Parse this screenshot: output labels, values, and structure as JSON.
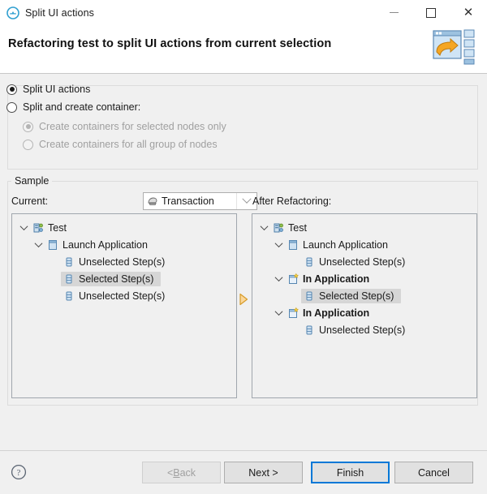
{
  "window": {
    "title": "Split UI actions",
    "icon": "split-ui-actions-icon",
    "controls": {
      "minimize": "minimize-icon",
      "maximize": "maximize-icon",
      "close": "close-icon"
    }
  },
  "header": {
    "title": "Refactoring test to split UI actions from current selection",
    "banner_icon": "refactoring-wizard-banner-icon"
  },
  "options": {
    "split_ui_actions": {
      "label": "Split UI actions",
      "checked": true,
      "enabled": true
    },
    "split_and_create_container": {
      "label": "Split and create container:",
      "checked": false,
      "enabled": true
    },
    "container_type": {
      "value": "Transaction",
      "icon": "transaction-icon"
    },
    "sub_selected_nodes_only": {
      "label": "Create containers for selected nodes only",
      "checked": true,
      "enabled": false
    },
    "sub_all_group_of_nodes": {
      "label": "Create containers for all group of nodes",
      "checked": false,
      "enabled": false
    }
  },
  "sample": {
    "legend": "Sample",
    "current_label": "Current:",
    "after_label": "After Refactoring:",
    "arrow_icon": "arrow-right-icon",
    "current_tree": [
      {
        "label": "Test",
        "indent": 0,
        "icon": "test-icon",
        "twisty": "expanded",
        "bold": false,
        "selected": false
      },
      {
        "label": "Launch Application",
        "indent": 1,
        "icon": "application-icon",
        "twisty": "expanded",
        "bold": false,
        "selected": false
      },
      {
        "label": "Unselected Step(s)",
        "indent": 2,
        "icon": "step-icon",
        "twisty": "none",
        "bold": false,
        "selected": false
      },
      {
        "label": "Selected Step(s)",
        "indent": 2,
        "icon": "step-icon",
        "twisty": "none",
        "bold": false,
        "selected": true
      },
      {
        "label": "Unselected Step(s)",
        "indent": 2,
        "icon": "step-icon",
        "twisty": "none",
        "bold": false,
        "selected": false
      }
    ],
    "after_tree": [
      {
        "label": "Test",
        "indent": 0,
        "icon": "test-icon",
        "twisty": "expanded",
        "bold": false,
        "selected": false
      },
      {
        "label": "Launch Application",
        "indent": 1,
        "icon": "application-icon",
        "twisty": "expanded",
        "bold": false,
        "selected": false
      },
      {
        "label": "Unselected Step(s)",
        "indent": 2,
        "icon": "step-icon",
        "twisty": "none",
        "bold": false,
        "selected": false
      },
      {
        "label": "In Application",
        "indent": 1,
        "icon": "new-application-icon",
        "twisty": "expanded",
        "bold": true,
        "selected": false
      },
      {
        "label": "Selected Step(s)",
        "indent": 2,
        "icon": "step-icon",
        "twisty": "none",
        "bold": false,
        "selected": true
      },
      {
        "label": "In Application",
        "indent": 1,
        "icon": "new-application-icon",
        "twisty": "expanded",
        "bold": true,
        "selected": false
      },
      {
        "label": "Unselected Step(s)",
        "indent": 2,
        "icon": "step-icon",
        "twisty": "none",
        "bold": false,
        "selected": false
      }
    ]
  },
  "footer": {
    "help_icon": "help-icon",
    "back": "< Back",
    "next": "Next >",
    "finish": "Finish",
    "cancel": "Cancel",
    "back_enabled": false,
    "default_button": "Finish"
  },
  "colors": {
    "accent": "#0078d7",
    "selection": "#d6d6d6",
    "arrow": "#f0a21e",
    "window_bg": "#f0f0f0"
  }
}
